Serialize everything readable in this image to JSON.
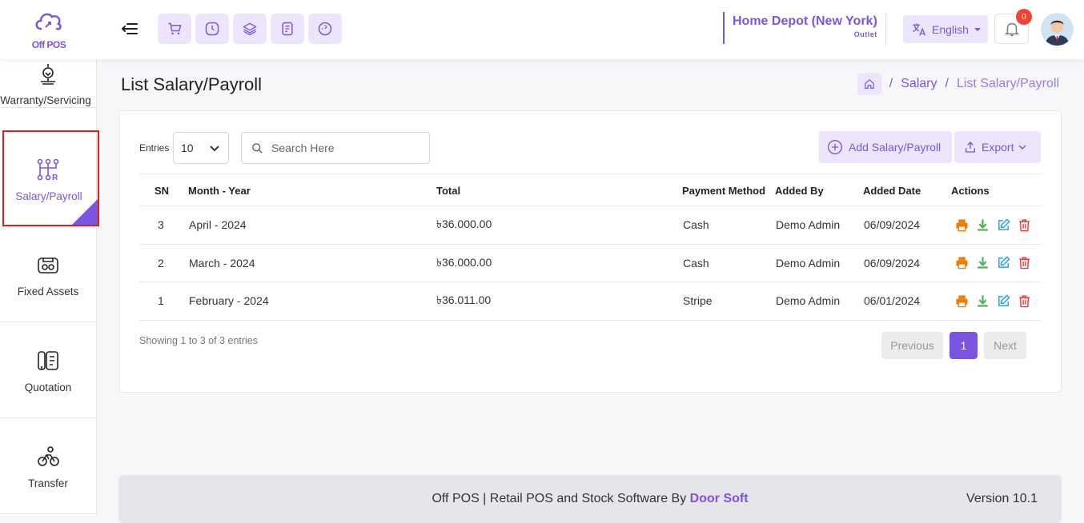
{
  "app": {
    "logo_text": "Off POS"
  },
  "header": {
    "outlet_name": "Home Depot (New York)",
    "outlet_sub": "Outlet",
    "language": "English",
    "notification_count": "0"
  },
  "sidebar": {
    "items": [
      {
        "label": "Warranty/Servicing"
      },
      {
        "label": "Salary/Payroll"
      },
      {
        "label": "Fixed Assets"
      },
      {
        "label": "Quotation"
      },
      {
        "label": "Transfer"
      }
    ]
  },
  "page": {
    "title": "List Salary/Payroll",
    "breadcrumb": {
      "sep1": "/",
      "parent": "Salary",
      "sep2": "/",
      "current": "List Salary/Payroll"
    }
  },
  "toolbar": {
    "entries_label": "Entries",
    "entries_value": "10",
    "search_placeholder": "Search Here",
    "add_label": "Add Salary/Payroll",
    "export_label": "Export"
  },
  "table": {
    "headers": {
      "sn": "SN",
      "month": "Month - Year",
      "total": "Total",
      "payment": "Payment Method",
      "added_by": "Added By",
      "added_date": "Added Date",
      "actions": "Actions"
    },
    "rows": [
      {
        "sn": "3",
        "month": "April - 2024",
        "total": "৳36.000.00",
        "payment": "Cash",
        "added_by": "Demo Admin",
        "added_date": "06/09/2024"
      },
      {
        "sn": "2",
        "month": "March - 2024",
        "total": "৳36.000.00",
        "payment": "Cash",
        "added_by": "Demo Admin",
        "added_date": "06/09/2024"
      },
      {
        "sn": "1",
        "month": "February - 2024",
        "total": "৳36.011.00",
        "payment": "Stripe",
        "added_by": "Demo Admin",
        "added_date": "06/01/2024"
      }
    ]
  },
  "pagination": {
    "showing": "Showing 1 to 3 of 3 entries",
    "previous": "Previous",
    "page": "1",
    "next": "Next"
  },
  "footer": {
    "text": "Off POS | Retail POS and Stock Software By ",
    "brand": "Door Soft",
    "version": "Version 10.1"
  },
  "colors": {
    "accent": "#7b55e0",
    "accent_light": "#ede5fc",
    "print": "#f07d00",
    "download": "#4caf50",
    "edit": "#2196f3",
    "delete": "#e53935"
  }
}
